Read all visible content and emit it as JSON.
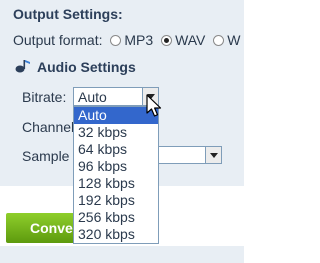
{
  "output_settings": {
    "heading": "Output Settings:",
    "format_label": "Output format:",
    "formats": [
      {
        "label": "MP3",
        "checked": false
      },
      {
        "label": "WAV",
        "checked": true
      },
      {
        "label": "W",
        "checked": false
      }
    ]
  },
  "audio_settings": {
    "heading": "Audio Settings",
    "icon": "music-note-icon"
  },
  "bitrate": {
    "label": "Bitrate:",
    "value": "Auto",
    "options": [
      "Auto",
      "32 kbps",
      "64 kbps",
      "96 kbps",
      "128 kbps",
      "192 kbps",
      "256 kbps",
      "320 kbps"
    ],
    "highlighted": "Auto"
  },
  "channels": {
    "label": "Channel"
  },
  "sample_rate": {
    "label": "Sample"
  },
  "convert_button": {
    "label": "Conver"
  },
  "colors": {
    "panel_bg": "#e8eef4",
    "heading": "#2c3f5a",
    "dropdown_highlight": "#3367cc",
    "convert_green": "#7ab520"
  }
}
